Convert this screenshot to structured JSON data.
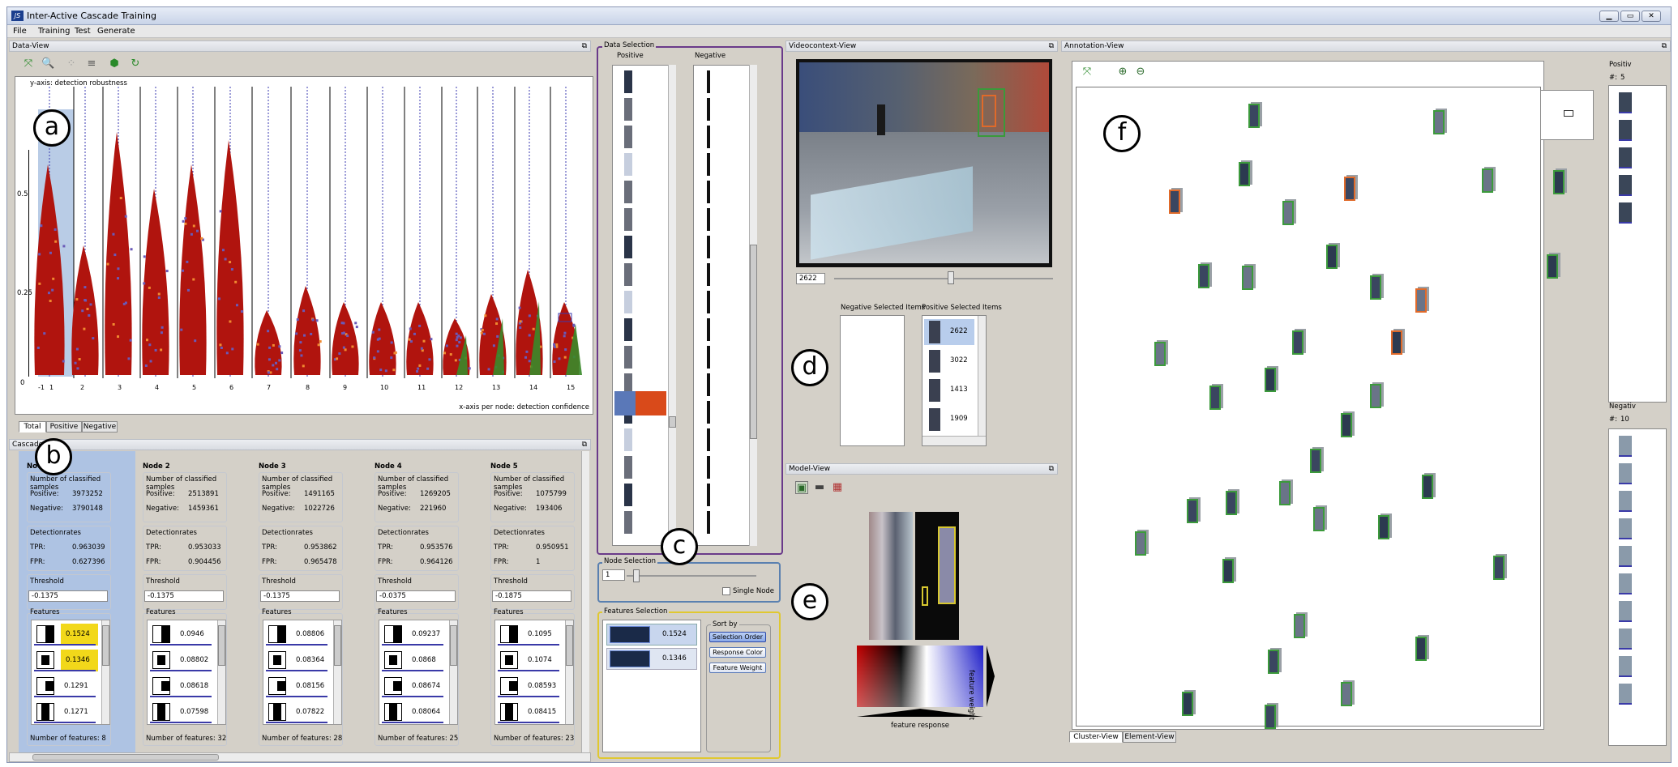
{
  "window": {
    "title": "Inter-Active Cascade Training",
    "icon": "JS"
  },
  "menu": [
    "File",
    "Training",
    "Test",
    "Generate"
  ],
  "data_view": {
    "header": "Data-View",
    "ylabel": "y-axis: detection robustness",
    "xlabel": "x-axis per node: detection confidence",
    "yticks": [
      "0.5",
      "0.25",
      "0"
    ],
    "xticks": [
      "-1",
      "1",
      "2",
      "3",
      "4",
      "5",
      "6",
      "7",
      "8",
      "9",
      "10",
      "11",
      "12",
      "13",
      "14",
      "15"
    ],
    "tabs": [
      "Total",
      "Positive",
      "Negative"
    ],
    "colors": {
      "negative": "#b0140e",
      "positive": "#3a8a2a",
      "feature": "#6a5ab8",
      "highlight": "#f08a30"
    }
  },
  "cascade": {
    "header": "Cascade",
    "nodes": [
      {
        "name": "Node 1",
        "positive": "3973252",
        "negative": "3790148",
        "tpr": "0.963039",
        "fpr": "0.627396",
        "threshold": "-0.1375",
        "features": [
          "0.1524",
          "0.1346",
          "0.1291",
          "0.1271"
        ],
        "count": "Number of features: 8"
      },
      {
        "name": "Node 2",
        "positive": "2513891",
        "negative": "1459361",
        "tpr": "0.953033",
        "fpr": "0.904456",
        "threshold": "-0.1375",
        "features": [
          "0.0946",
          "0.08802",
          "0.08618",
          "0.07598"
        ],
        "count": "Number of features: 32"
      },
      {
        "name": "Node 3",
        "positive": "1491165",
        "negative": "1022726",
        "tpr": "0.953862",
        "fpr": "0.965478",
        "threshold": "-0.1375",
        "features": [
          "0.08806",
          "0.08364",
          "0.08156",
          "0.07822"
        ],
        "count": "Number of features: 28"
      },
      {
        "name": "Node 4",
        "positive": "1269205",
        "negative": "221960",
        "tpr": "0.953576",
        "fpr": "0.964126",
        "threshold": "-0.0375",
        "features": [
          "0.09237",
          "0.0868",
          "0.08674",
          "0.08064"
        ],
        "count": "Number of features: 25"
      },
      {
        "name": "Node 5",
        "positive": "1075799",
        "negative": "193406",
        "tpr": "0.950951",
        "fpr": "1",
        "threshold": "-0.1875",
        "features": [
          "0.1095",
          "0.1074",
          "0.08593",
          "0.08415"
        ],
        "count": "Number of features: 23"
      }
    ],
    "labels": {
      "samples": "Number of classified samples",
      "positive": "Positive:",
      "negative": "Negative:",
      "rates": "Detectionrates",
      "tpr": "TPR:",
      "fpr": "FPR:",
      "threshold": "Threshold",
      "features": "Features"
    }
  },
  "data_selection": {
    "header": "Data Selection",
    "positive": "Positive",
    "negative": "Negative"
  },
  "node_selection": {
    "header": "Node Selection",
    "value": "1",
    "single": "Single Node"
  },
  "features_selection": {
    "header": "Features Selection",
    "items": [
      "0.1524",
      "0.1346"
    ],
    "sort_header": "Sort by",
    "sort": [
      "Selection Order",
      "Response Color",
      "Feature Weight"
    ]
  },
  "video": {
    "header": "Videocontext-View",
    "frame": "2622"
  },
  "selected": {
    "neg_header": "Negative Selected Items",
    "pos_header": "Positive Selected Items",
    "pos_items": [
      "2622",
      "3022",
      "1413",
      "1909"
    ]
  },
  "model_view": {
    "header": "Model-View",
    "xlabel": "feature response",
    "ylabel": "feature weight"
  },
  "annotation": {
    "header": "Annotation-View",
    "tabs": [
      "Cluster-View",
      "Element-View"
    ],
    "positive": {
      "label": "Positiv",
      "count_label": "#:",
      "count": "5"
    },
    "negative": {
      "label": "Negativ",
      "count_label": "#:",
      "count": "10"
    }
  },
  "callouts": [
    "a",
    "b",
    "c",
    "d",
    "e",
    "f"
  ]
}
